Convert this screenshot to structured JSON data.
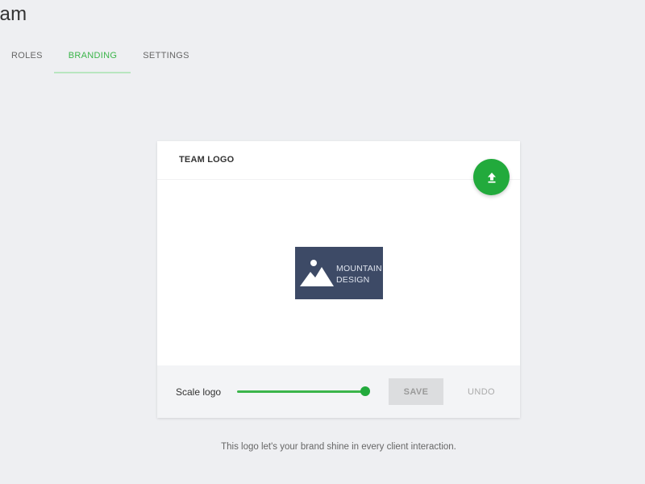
{
  "header": {
    "title": "eam"
  },
  "tabs": [
    {
      "label": "ROLES",
      "active": false
    },
    {
      "label": "BRANDING",
      "active": true
    },
    {
      "label": "SETTINGS",
      "active": false
    }
  ],
  "card": {
    "title": "TEAM LOGO",
    "upload_icon": "upload-icon",
    "logo": {
      "line1": "MOUNTAIN",
      "line2": "DESIGN",
      "icon": "mountain-image-icon"
    },
    "footer": {
      "scale_label": "Scale logo",
      "slider_level": 0.98,
      "save_label": "SAVE",
      "undo_label": "UNDO"
    }
  },
  "caption": "This logo let's your brand shine in every client interaction.",
  "colors": {
    "accent": "#22aa3c",
    "tab_active": "#3bb54a",
    "background": "#eeeff2",
    "logo_bg": "#3d4a66"
  }
}
